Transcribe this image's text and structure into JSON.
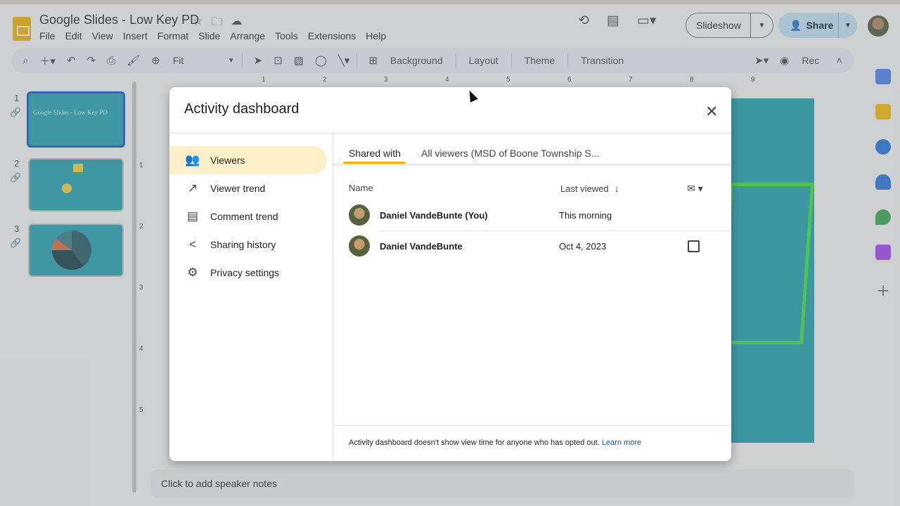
{
  "app": {
    "doc_title": "Google Slides - Low Key PD",
    "menu": [
      "File",
      "Edit",
      "View",
      "Insert",
      "Format",
      "Slide",
      "Arrange",
      "Tools",
      "Extensions",
      "Help"
    ],
    "slideshow_label": "Slideshow",
    "share_label": "Share"
  },
  "toolbar": {
    "zoom_label": "Fit",
    "background_label": "Background",
    "layout_label": "Layout",
    "theme_label": "Theme",
    "transition_label": "Transition",
    "rec_label": "Rec"
  },
  "slides": [
    {
      "num": "1",
      "title_text": "Google Slides - Low Key PD"
    },
    {
      "num": "2"
    },
    {
      "num": "3"
    }
  ],
  "ruler": {
    "top": [
      "1",
      "2",
      "3",
      "4",
      "5",
      "6",
      "7",
      "8",
      "9"
    ],
    "left": [
      "1",
      "2",
      "3",
      "4",
      "5"
    ]
  },
  "notes_placeholder": "Click to add speaker notes",
  "dialog": {
    "title": "Activity dashboard",
    "nav": [
      {
        "label": "Viewers",
        "icon": "people-icon"
      },
      {
        "label": "Viewer trend",
        "icon": "trend-icon"
      },
      {
        "label": "Comment trend",
        "icon": "comment-icon"
      },
      {
        "label": "Sharing history",
        "icon": "share-icon"
      },
      {
        "label": "Privacy settings",
        "icon": "gear-icon"
      }
    ],
    "tabs": [
      "Shared with",
      "All viewers (MSD of Boone Township S..."
    ],
    "columns": {
      "name": "Name",
      "last_viewed": "Last viewed"
    },
    "rows": [
      {
        "name": "Daniel VandeBunte (You)",
        "last_viewed": "This morning"
      },
      {
        "name": "Daniel VandeBunte",
        "last_viewed": "Oct 4, 2023"
      }
    ],
    "footer_text": "Activity dashboard doesn't show view time for anyone who has opted out.",
    "footer_link": "Learn more"
  },
  "colors": {
    "accent": "#0b57d0",
    "active_nav": "#fdf0c8",
    "tab_underline": "#f4b400",
    "share_bg": "#c2e7ff",
    "slide_teal": "#1aa3b5"
  }
}
